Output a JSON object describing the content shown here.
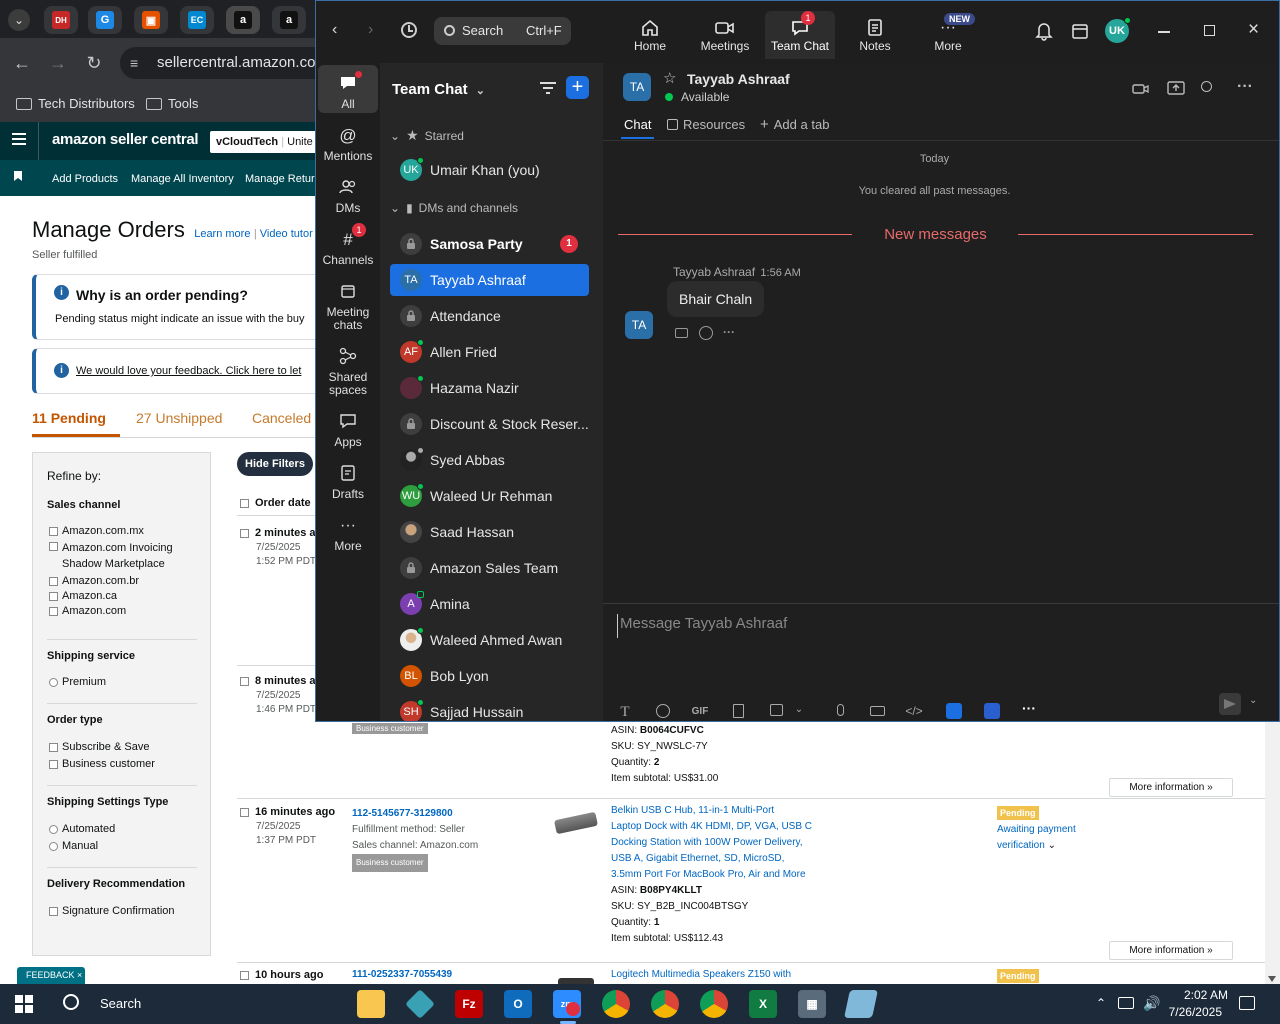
{
  "browser": {
    "url": "sellercentral.amazon.com",
    "bookmarks": [
      "Tech Distributors",
      "Tools"
    ]
  },
  "amazon": {
    "logo": "amazon seller central",
    "store": "vCloudTech",
    "store_suffix": "Unite",
    "nav": [
      "Add Products",
      "Manage All Inventory",
      "Manage Retur"
    ],
    "page_title": "Manage Orders",
    "learn_more": "Learn more",
    "video": "Video tutor",
    "subtitle": "Seller fulfilled",
    "pending_title": "Why is an order pending?",
    "pending_text": "Pending status might indicate an issue with the buy",
    "feedback_text": "We would love your feedback. Click here to let",
    "tabs": {
      "pending_count": "11",
      "pending": "Pending",
      "unshipped_count": "27",
      "unshipped": "Unshipped",
      "canceled": "Canceled"
    },
    "hide_filters": "Hide Filters",
    "order_date_header": "Order date",
    "refine_by": "Refine by:",
    "filters": {
      "sales_channel": {
        "title": "Sales channel",
        "options": [
          "Amazon.com.mx",
          "Amazon.com Invoicing Shadow Marketplace",
          "Amazon.com.br",
          "Amazon.ca",
          "Amazon.com"
        ]
      },
      "shipping_service": {
        "title": "Shipping service",
        "options": [
          "Premium"
        ]
      },
      "order_type": {
        "title": "Order type",
        "options": [
          "Subscribe & Save",
          "Business customer"
        ]
      },
      "shipping_settings": {
        "title": "Shipping Settings Type",
        "options": [
          "Automated",
          "Manual"
        ]
      },
      "delivery": {
        "title": "Delivery Recommendation",
        "options": [
          "Signature Confirmation"
        ]
      }
    },
    "orders": [
      {
        "age": "2 minutes ag",
        "date": "7/25/2025",
        "time": "1:52 PM PDT"
      },
      {
        "age": "8 minutes ag",
        "date": "7/25/2025",
        "time": "1:46 PM PDT",
        "badge": "Business customer",
        "asin": "B0064CUFVC",
        "sku": "SY_NWSLC-7Y",
        "qty": "2",
        "subtotal": "US$31.00",
        "more": "More information"
      },
      {
        "age": "16 minutes ago",
        "date": "7/25/2025",
        "time": "1:37 PM PDT",
        "order_id": "112-5145677-3129800",
        "fulfillment": "Fulfillment method: Seller",
        "channel": "Sales channel: Amazon.com",
        "badge": "Business customer",
        "title_lines": [
          "Belkin USB C Hub, 11-in-1 Multi-Port",
          "Laptop Dock with 4K HDMI, DP, VGA, USB C",
          "Docking Station with 100W Power Delivery,",
          "USB A, Gigabit Ethernet, SD, MicroSD,",
          "3.5mm Port For MacBook Pro, Air and More"
        ],
        "asin": "B08PY4KLLT",
        "sku": "SY_B2B_INC004BTSGY",
        "qty": "1",
        "subtotal": "US$112.43",
        "status": "Pending",
        "status_detail_1": "Awaiting payment",
        "status_detail_2": "verification",
        "more": "More information"
      },
      {
        "age": "10 hours ago",
        "order_id": "111-0252337-7055439",
        "title": "Logitech Multimedia Speakers Z150 with",
        "status": "Pending"
      }
    ],
    "labels": {
      "asin": "ASIN: ",
      "sku": "SKU: ",
      "qty": "Quantity: ",
      "subtotal": "Item subtotal: "
    },
    "feedback_btn": "FEEDBACK"
  },
  "zoom": {
    "search": "Search",
    "search_shortcut": "Ctrl+F",
    "topnav": [
      {
        "label": "Home"
      },
      {
        "label": "Meetings"
      },
      {
        "label": "Team Chat",
        "badge": "1"
      },
      {
        "label": "Notes"
      },
      {
        "label": "More",
        "badge": "NEW"
      }
    ],
    "user_initials": "UK",
    "rail": [
      {
        "label": "All"
      },
      {
        "label": "Mentions"
      },
      {
        "label": "DMs"
      },
      {
        "label": "Channels",
        "badge": "1"
      },
      {
        "label": "Meeting chats"
      },
      {
        "label": "Shared spaces"
      },
      {
        "label": "Apps"
      },
      {
        "label": "Drafts"
      },
      {
        "label": "More"
      }
    ],
    "list_title": "Team Chat",
    "starred": "Starred",
    "dms_channels": "DMs and channels",
    "me": {
      "initials": "UK",
      "name": "Umair Khan (you)"
    },
    "items": [
      {
        "name": "Samosa Party",
        "type": "lock",
        "badge": "1"
      },
      {
        "name": "Tayyab Ashraaf",
        "initials": "TA",
        "color": "#2a6fa8"
      },
      {
        "name": "Attendance",
        "type": "lock"
      },
      {
        "name": "Allen Fried",
        "initials": "AF",
        "color": "#c0392b"
      },
      {
        "name": "Hazama Nazir",
        "initials": "",
        "color": "#5a2a3a"
      },
      {
        "name": "Discount & Stock Reser...",
        "type": "lock"
      },
      {
        "name": "Syed Abbas",
        "initials": "",
        "color": "#444"
      },
      {
        "name": "Waleed Ur Rehman",
        "initials": "WU",
        "color": "#2e9e3e"
      },
      {
        "name": "Saad Hassan",
        "initials": "",
        "color": "#555"
      },
      {
        "name": "Amazon Sales Team",
        "type": "lock"
      },
      {
        "name": "Amina",
        "initials": "A",
        "color": "#7b3fb0"
      },
      {
        "name": "Waleed Ahmed Awan",
        "initials": "",
        "color": "#666"
      },
      {
        "name": "Bob Lyon",
        "initials": "BL",
        "color": "#d35400"
      },
      {
        "name": "Sajjad Hussain",
        "initials": "SH",
        "color": "#c0392b"
      }
    ],
    "chat": {
      "initials": "TA",
      "name": "Tayyab Ashraaf",
      "status": "Available",
      "tabs": [
        "Chat",
        "Resources",
        "Add a tab"
      ],
      "day": "Today",
      "cleared": "You cleared all past messages.",
      "new_messages": "New messages",
      "msg_sender": "Tayyab Ashraaf",
      "msg_time": "1:56 AM",
      "msg_text": "Bhair Chaln",
      "placeholder": "Message Tayyab Ashraaf",
      "gif": "GIF"
    }
  },
  "taskbar": {
    "search": "Search",
    "time": "2:02 AM",
    "date": "7/26/2025"
  },
  "colors": {
    "zoom_blue": "#1b6fe0",
    "badge_red": "#e02f3f",
    "amazon_teal": "#002f36",
    "pending_orange": "#c45500"
  }
}
